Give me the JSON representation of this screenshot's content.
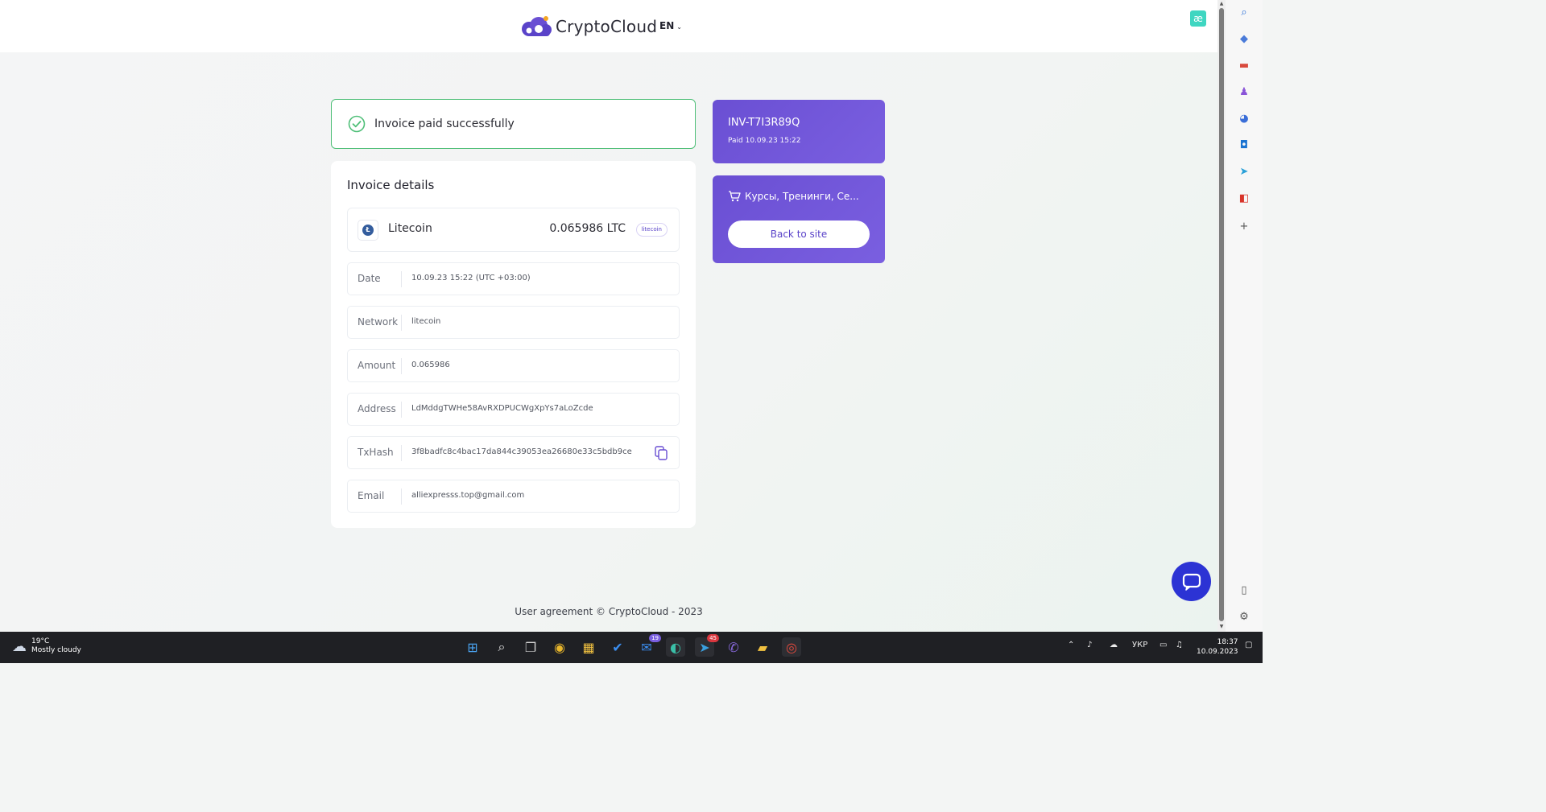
{
  "header": {
    "brand": "CryptoCloud",
    "language": "EN"
  },
  "status": {
    "message": "Invoice paid successfully"
  },
  "details": {
    "title": "Invoice details",
    "coin": {
      "name": "Litecoin",
      "amount": "0.065986 LTC",
      "badge": "litecoin"
    },
    "fields": [
      {
        "label": "Date",
        "value": "10.09.23 15:22 (UTC +03:00)"
      },
      {
        "label": "Network",
        "value": "litecoin"
      },
      {
        "label": "Amount",
        "value": "0.065986"
      },
      {
        "label": "Address",
        "value": "LdMddgTWHe58AvRXDPUCWgXpYs7aLoZcde"
      },
      {
        "label": "TxHash",
        "value": "3f8badfc8c4bac17da844c39053ea26680e33c5bdb9ce"
      },
      {
        "label": "Email",
        "value": "alliexpresss.top@gmail.com"
      }
    ]
  },
  "invoice": {
    "id": "INV-T7I3R89Q",
    "paid": "Paid 10.09.23 15:22"
  },
  "shop": {
    "name": "Курсы, Тренинги, Се...",
    "back_label": "Back to site"
  },
  "footer": {
    "text": "User agreement © CryptoCloud - 2023"
  },
  "taskbar": {
    "weather_temp": "19°C",
    "weather_desc": "Mostly cloudy",
    "badge_mail": "19",
    "badge_telegram": "45",
    "lang": "УКР",
    "time": "18:37",
    "date": "10.09.2023"
  },
  "colors": {
    "accent": "#6a4fd3",
    "success": "#4fbf78",
    "chat": "#2c33d4"
  }
}
